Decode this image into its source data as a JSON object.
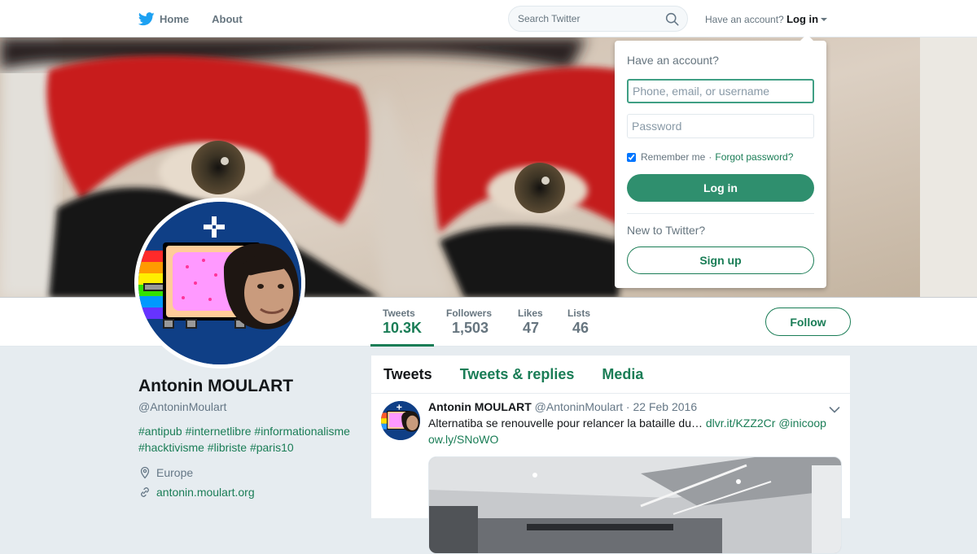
{
  "nav": {
    "home_label": "Home",
    "about_label": "About",
    "search_placeholder": "Search Twitter",
    "account_prompt": "Have an account?",
    "login_toggle": "Log in"
  },
  "login_dropdown": {
    "heading": "Have an account?",
    "username_placeholder": "Phone, email, or username",
    "password_placeholder": "Password",
    "remember_me": "Remember me",
    "separator": "·",
    "forgot_password": "Forgot password?",
    "remember_checked": true,
    "login_button": "Log in",
    "new_prompt": "New to Twitter?",
    "signup_button": "Sign up"
  },
  "stats": [
    {
      "label": "Tweets",
      "value": "10.3K"
    },
    {
      "label": "Followers",
      "value": "1,503"
    },
    {
      "label": "Likes",
      "value": "47"
    },
    {
      "label": "Lists",
      "value": "46"
    }
  ],
  "follow_label": "Follow",
  "profile": {
    "name": "Antonin MOULART",
    "handle": "@AntoninMoulart",
    "bio_line1": "#antipub #internetlibre #informationalisme",
    "bio_line2": "#hacktivisme #libriste #paris10",
    "location": "Europe",
    "website": "antonin.moulart.org"
  },
  "timeline": {
    "tabs": [
      "Tweets",
      "Tweets & replies",
      "Media"
    ],
    "tweet": {
      "author": "Antonin MOULART",
      "handle": "@AntoninMoulart",
      "separator": "·",
      "date": "22 Feb 2016",
      "text": "Alternatiba se renouvelle pour relancer la bataille du…",
      "link1": "dlvr.it/KZZ2Cr",
      "link2": "@inicoop",
      "link3": "ow.ly/SNoWO"
    }
  },
  "colors": {
    "accent": "#1a7d56",
    "avatar_bg": "#0f3f86"
  },
  "icons": [
    "twitter-bird-icon",
    "search-icon",
    "chevron-down-icon",
    "location-pin-icon",
    "link-icon"
  ]
}
